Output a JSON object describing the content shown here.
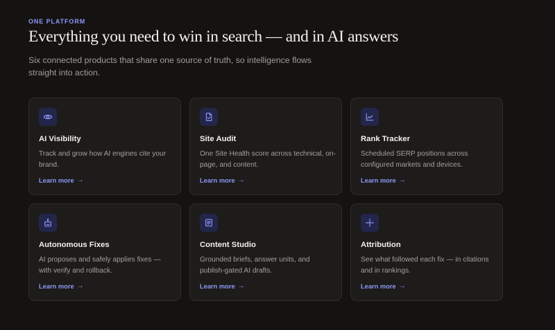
{
  "section": {
    "eyebrow": "ONE PLATFORM",
    "headline": "Everything you need to win in search — and in AI answers",
    "subhead": "Six connected products that share one source of truth, so intelligence flows straight into action."
  },
  "colors": {
    "background": "#141312",
    "card_background": "#1d1c1b",
    "card_border": "#2e2d2b",
    "accent": "#8e97f5",
    "icon_background": "#23264a"
  },
  "cards": [
    {
      "icon": "eye-icon",
      "title": "AI Visibility",
      "description": "Track and grow how AI engines cite your brand.",
      "link": "Learn more",
      "link_arrow": "→"
    },
    {
      "icon": "file-check-icon",
      "title": "Site Audit",
      "description": "One Site Health score across technical, on-page, and content.",
      "link": "Learn more",
      "link_arrow": "→"
    },
    {
      "icon": "line-chart-icon",
      "title": "Rank Tracker",
      "description": "Scheduled SERP positions across configured markets and devices.",
      "link": "Learn more",
      "link_arrow": "→"
    },
    {
      "icon": "robot-icon",
      "title": "Autonomous Fixes",
      "description": "AI proposes and safely applies fixes — with verify and rollback.",
      "link": "Learn more",
      "link_arrow": "→"
    },
    {
      "icon": "document-icon",
      "title": "Content Studio",
      "description": "Grounded briefs, answer units, and publish-gated AI drafts.",
      "link": "Learn more",
      "link_arrow": "→"
    },
    {
      "icon": "crosshair-icon",
      "title": "Attribution",
      "description": "See what followed each fix — in citations and in rankings.",
      "link": "Learn more",
      "link_arrow": "→"
    }
  ]
}
